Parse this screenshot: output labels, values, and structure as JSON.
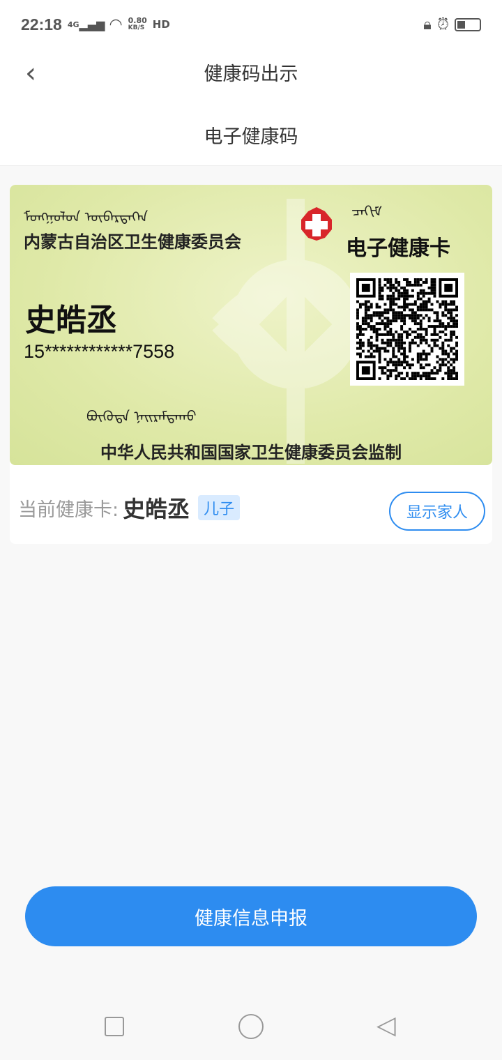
{
  "status_bar": {
    "time": "22:18",
    "network": "4G",
    "speed": "0.80",
    "speed_unit": "KB/S",
    "hd": "HD",
    "icons": [
      "signal-icon",
      "wifi-icon",
      "rotation-lock-icon",
      "alarm-icon",
      "battery-icon"
    ],
    "battery_percent": 30
  },
  "header": {
    "title": "健康码出示",
    "subtitle": "电子健康码"
  },
  "card": {
    "issuer": "内蒙古自治区卫生健康委员会",
    "card_title": "电子健康卡",
    "name": "史皓丞",
    "id_number": "15************7558",
    "footer": "中华人民共和国国家卫生健康委员会监制",
    "colors": {
      "card_bg": "#dfe9a8",
      "cross": "#d8262a"
    }
  },
  "current": {
    "label": "当前健康卡:",
    "name": "史皓丞",
    "relation": "儿子",
    "show_family": "显示家人"
  },
  "report_button": "健康信息申报",
  "colors": {
    "accent": "#2d8cf0"
  }
}
